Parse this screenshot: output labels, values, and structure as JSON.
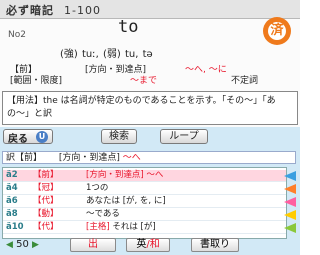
{
  "header": {
    "title": "必ず暗記",
    "range": "1-100"
  },
  "word": {
    "number": "No2",
    "headword": "to",
    "stamp": "済",
    "pronunciation": "(強) tuː, (弱) tu, tə"
  },
  "parts": {
    "row1": {
      "pos": "【前】",
      "meaning": "[方向・到達点]",
      "gloss": "〜へ, 〜に"
    },
    "row2": {
      "label": "[範囲・限度]",
      "gloss": "〜まで",
      "note": "不定詞"
    }
  },
  "usage": "【用法】the は名詞が特定のものであることを示す。「その〜」「あの〜」と訳",
  "toolbar": {
    "back_label": "戻る",
    "back_key": "U",
    "search_label": "検索",
    "loop_label": "ループ"
  },
  "translation": {
    "label": "訳【前】",
    "text": "[方向・到達点]",
    "gloss": "〜へ"
  },
  "list": [
    {
      "num": "ä2",
      "pos": "【前】",
      "meaning": "[方向・到達点] 〜へ"
    },
    {
      "num": "ä4",
      "pos": "【冠】",
      "meaning": "1つの"
    },
    {
      "num": "ä6",
      "pos": "【代】",
      "meaning": "あなたは [が, を, に]"
    },
    {
      "num": "ä8",
      "pos": "【動】",
      "meaning": "〜である"
    },
    {
      "num": "ä10",
      "pos": "【代】",
      "meaning_red": "[主格]",
      "meaning_black": "それは [が]"
    }
  ],
  "tab_colors": [
    "#3a9fe0",
    "#ff7f2a",
    "#ff5fa0",
    "#ffcc00",
    "#8ac83a"
  ],
  "footer": {
    "count": "50",
    "button1": "出",
    "button2_a": "英",
    "button2_sep": "/",
    "button2_b": "和",
    "button3": "書取り"
  }
}
